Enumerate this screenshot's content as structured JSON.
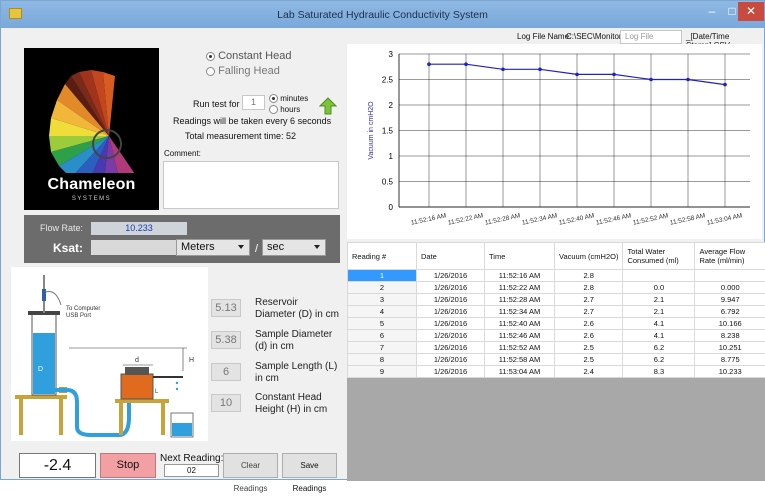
{
  "window": {
    "title": "Lab Saturated Hydraulic Conductivity System",
    "min": "–",
    "max": "□",
    "close": "✕"
  },
  "logo": {
    "brand": "Chameleon",
    "sub": "SYSTEMS"
  },
  "mode": {
    "constant": "Constant Head",
    "falling": "Falling Head",
    "selected": "constant"
  },
  "run": {
    "label": "Run test for",
    "value": "1",
    "unit_minutes": "minutes",
    "unit_hours": "hours",
    "readings_text": "Readings will be taken every 6 seconds",
    "total_text": "Total measurement time:  52"
  },
  "comment": {
    "label": "Comment:"
  },
  "flow": {
    "flow_label": "Flow Rate:",
    "flow_value": "10.233",
    "ksat_label": "Ksat:",
    "unit1": "Meters",
    "slash": "/",
    "unit2": "sec"
  },
  "diagram": {
    "computer_label": "To Computer",
    "usb_label": "USB Port",
    "D": "D",
    "d": "d",
    "H": "H",
    "L": "L"
  },
  "params": [
    {
      "value": "5.13",
      "label": "Reservoir Diameter (D) in cm"
    },
    {
      "value": "5.38",
      "label": "Sample Diameter (d) in cm"
    },
    {
      "value": "6",
      "label": "Sample Length (L) in cm"
    },
    {
      "value": "10",
      "label": "Constant Head Height (H) in cm"
    }
  ],
  "bottom": {
    "current": "-2.4",
    "stop": "Stop",
    "next_label": "Next Reading:",
    "next_value": "02",
    "clear": "Clear Readings",
    "save": "Save Readings"
  },
  "logfile": {
    "label": "Log File Name:",
    "path": "C:\\SEC\\Monitor\\",
    "placeholder": "Log File",
    "suffix": "_[Date/Time Stamp].CSV"
  },
  "colors": {
    "line": "#2020c8",
    "selected_row": "#3399ff",
    "stop": "#f3a0a4"
  },
  "chart_data": {
    "type": "line",
    "x": [
      "11:52:16 AM",
      "11:52:22 AM",
      "11:52:28 AM",
      "11:52:34 AM",
      "11:52:40 AM",
      "11:52:46 AM",
      "11:52:52 AM",
      "11:52:58 AM",
      "11:53:04 AM"
    ],
    "values": [
      2.8,
      2.8,
      2.7,
      2.7,
      2.6,
      2.6,
      2.5,
      2.5,
      2.4
    ],
    "ylabel": "Vacuum in cmH2O",
    "ylim": [
      0,
      3
    ],
    "yticks": [
      "0",
      "0.5",
      "1",
      "1.5",
      "2",
      "2.5",
      "3"
    ],
    "grid": true
  },
  "table": {
    "headers": [
      "Reading #",
      "Date",
      "Time",
      "Vacuum (cmH2O)",
      "Total Water Consumed (ml)",
      "Average Flow Rate (ml/min)"
    ],
    "rows": [
      [
        "1",
        "1/26/2016",
        "11:52:16 AM",
        "2.8",
        "",
        ""
      ],
      [
        "2",
        "1/26/2016",
        "11:52:22 AM",
        "2.8",
        "0.0",
        "0.000"
      ],
      [
        "3",
        "1/26/2016",
        "11:52:28 AM",
        "2.7",
        "2.1",
        "9.947"
      ],
      [
        "4",
        "1/26/2016",
        "11:52:34 AM",
        "2.7",
        "2.1",
        "6.792"
      ],
      [
        "5",
        "1/26/2016",
        "11:52:40 AM",
        "2.6",
        "4.1",
        "10.166"
      ],
      [
        "6",
        "1/26/2016",
        "11:52:46 AM",
        "2.6",
        "4.1",
        "8.238"
      ],
      [
        "7",
        "1/26/2016",
        "11:52:52 AM",
        "2.5",
        "6.2",
        "10.251"
      ],
      [
        "8",
        "1/26/2016",
        "11:52:58 AM",
        "2.5",
        "6.2",
        "8.775"
      ],
      [
        "9",
        "1/26/2016",
        "11:53:04 AM",
        "2.4",
        "8.3",
        "10.233"
      ]
    ]
  }
}
